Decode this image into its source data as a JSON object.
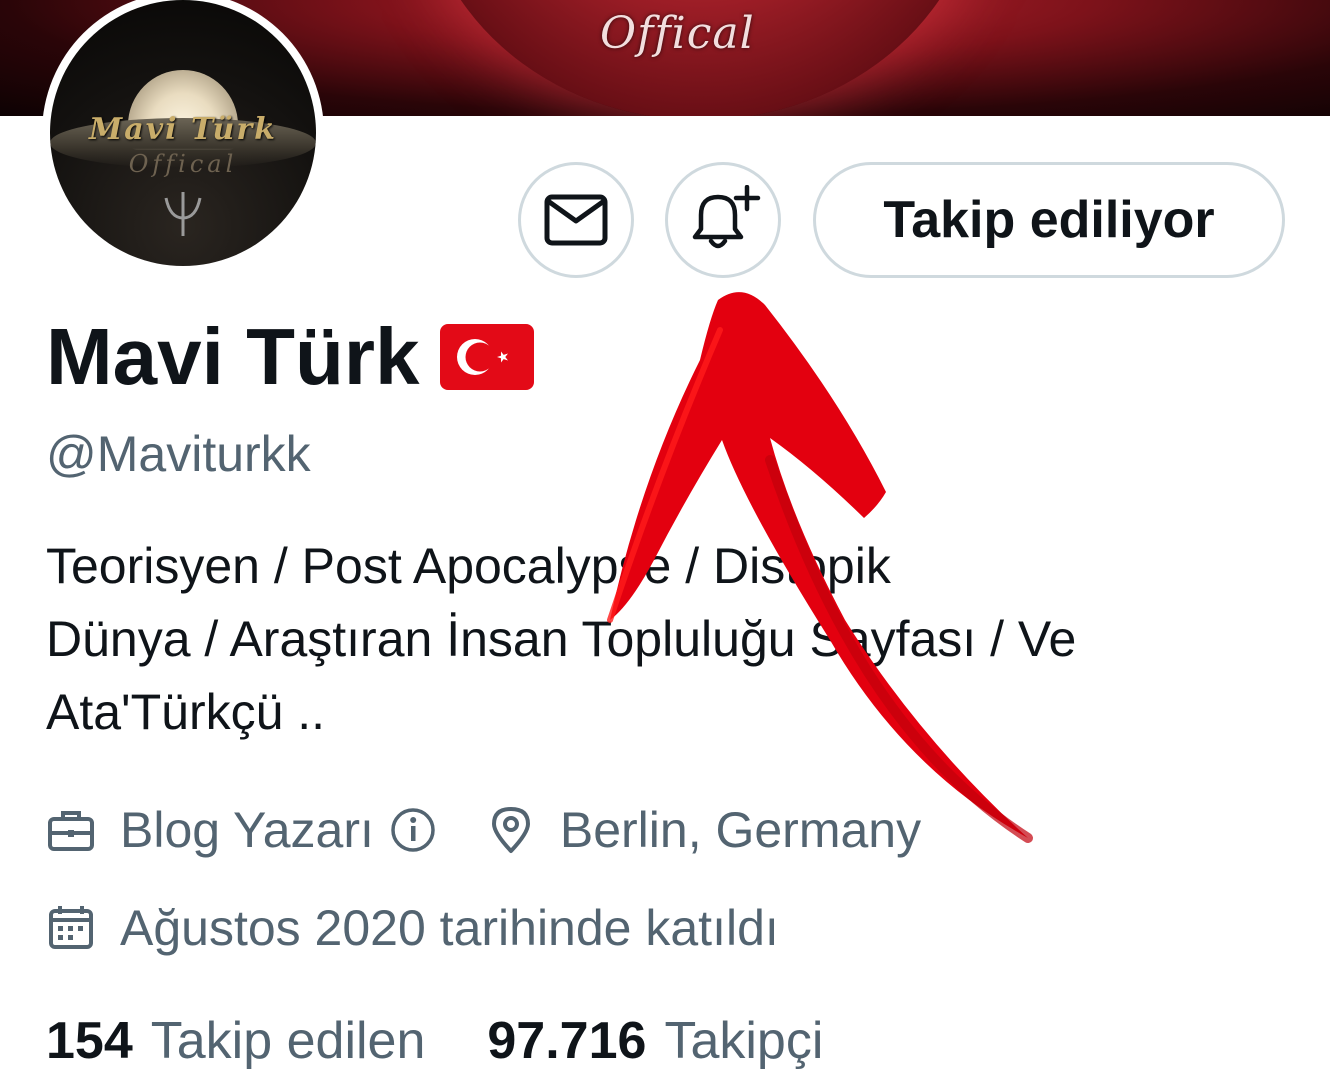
{
  "banner": {
    "text": "Offical"
  },
  "avatar": {
    "title": "Mavi Türk",
    "subtitle": "Offical"
  },
  "actions": {
    "follow_label": "Takip ediliyor"
  },
  "profile": {
    "name": "Mavi Türk",
    "flag_icon": "turkey-flag-icon",
    "handle": "@Maviturkk",
    "bio_lines": [
      "Teorisyen / Post Apocalypse / Distopik",
      "Dünya / Araştıran İnsan Topluluğu Sayfası / Ve",
      "Ata'Türkçü .."
    ],
    "category": "Blog Yazarı",
    "location": "Berlin, Germany",
    "joined": "Ağustos 2020 tarihinde katıldı"
  },
  "stats": {
    "following_count": "154",
    "following_label": "Takip edilen",
    "followers_count": "97.716",
    "followers_label": "Takipçi"
  },
  "colors": {
    "text_primary": "#0f1419",
    "text_secondary": "#536471",
    "border": "#cfd9de",
    "annotation_arrow": "#e3000f"
  }
}
